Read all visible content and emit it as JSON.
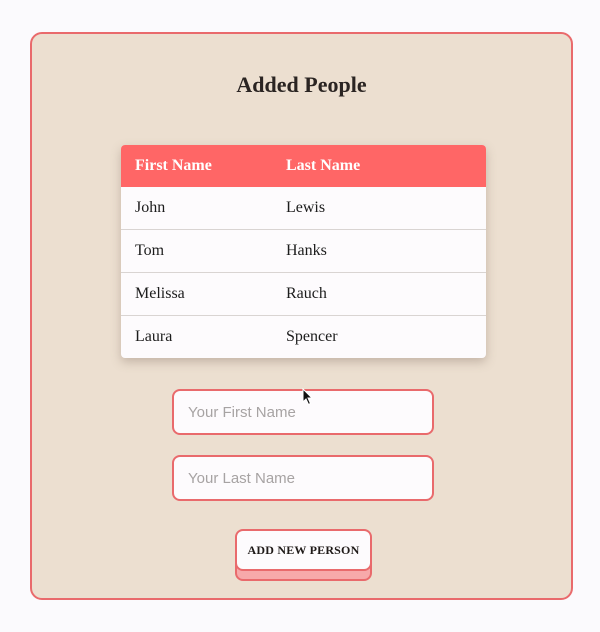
{
  "page": {
    "title": "Added People"
  },
  "table": {
    "headers": [
      "First Name",
      "Last Name"
    ],
    "rows": [
      {
        "first": "John",
        "last": "Lewis"
      },
      {
        "first": "Tom",
        "last": "Hanks"
      },
      {
        "first": "Melissa",
        "last": "Rauch"
      },
      {
        "first": "Laura",
        "last": "Spencer"
      }
    ]
  },
  "form": {
    "first_name": {
      "value": "",
      "placeholder": "Your First Name"
    },
    "last_name": {
      "value": "",
      "placeholder": "Your Last Name"
    },
    "submit_label": "ADD NEW PERSON"
  },
  "colors": {
    "accent": "#ff6666",
    "border": "#e96a6c",
    "card_background": "#ecdfd0",
    "page_background": "#fbfafd"
  }
}
